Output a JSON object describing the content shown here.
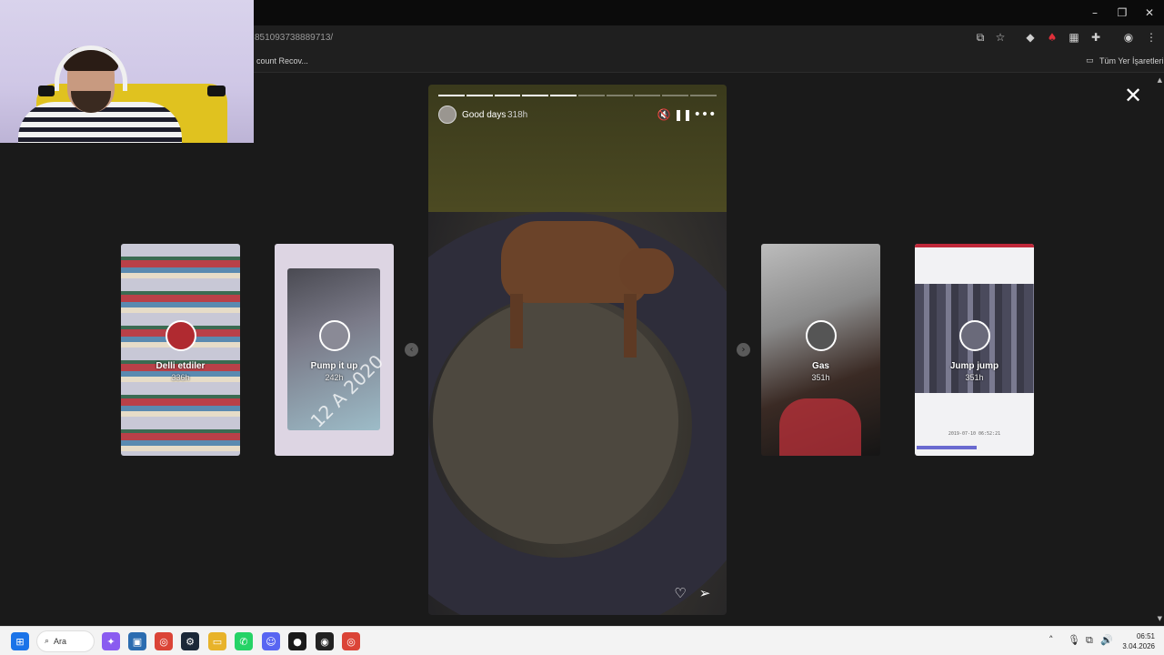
{
  "browser": {
    "url": "851093738889713/",
    "bookmark_left": "count Recov...",
    "bookmark_right": "Tüm Yer İşaretleri"
  },
  "story": {
    "username": "Good days",
    "time": "318h",
    "progress_total": 10,
    "progress_done": 5
  },
  "thumbnails": [
    {
      "title": "Delli etdiler",
      "time": "336h"
    },
    {
      "title": "Pump it up",
      "time": "242h",
      "overlay_text": "12 A 2020"
    },
    {
      "title": "Gas",
      "time": "351h"
    },
    {
      "title": "Jump jump",
      "time": "351h",
      "stamp": "2019-07-10  06:52:21"
    }
  ],
  "taskbar": {
    "search_label": "Ara",
    "time": "06:51",
    "date": "3.04.2026"
  },
  "colors": {
    "stage_bg": "#1a1a1a",
    "taskbar_bg": "#f3f3f3",
    "titlebar_bg": "#0b0b0b"
  }
}
